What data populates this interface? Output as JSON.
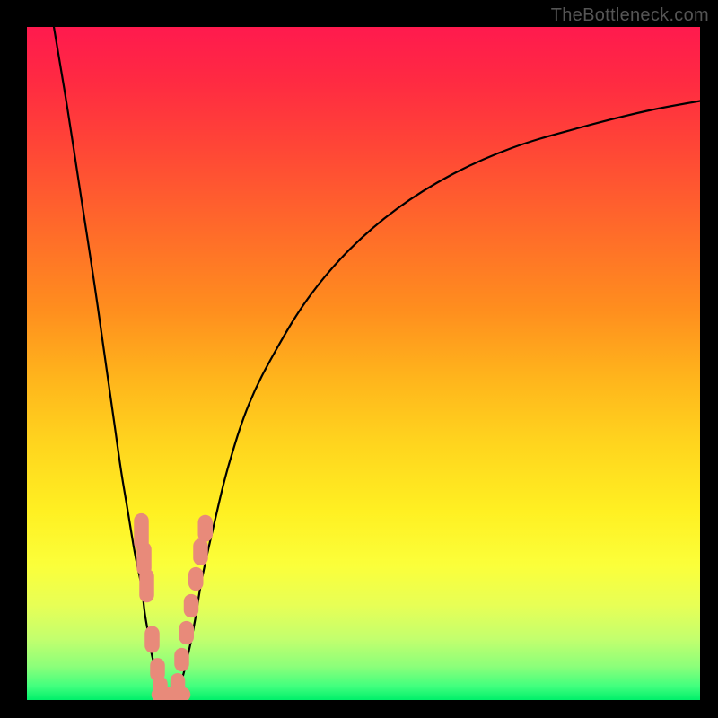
{
  "watermark": "TheBottleneck.com",
  "chart_data": {
    "type": "line",
    "title": "",
    "xlabel": "",
    "ylabel": "",
    "xlim": [
      0,
      100
    ],
    "ylim": [
      0,
      100
    ],
    "series": [
      {
        "name": "left-curve",
        "x": [
          4,
          6,
          8,
          10,
          12,
          13,
          14,
          15,
          16,
          17,
          17.5,
          18,
          18.5,
          19,
          19.5,
          20,
          20.5
        ],
        "values": [
          100,
          88,
          75,
          62,
          48,
          41,
          34,
          28,
          22,
          17,
          13,
          10,
          7,
          5,
          3.5,
          2,
          1
        ]
      },
      {
        "name": "right-curve",
        "x": [
          22,
          23,
          24,
          25,
          26,
          28,
          30,
          33,
          37,
          42,
          48,
          55,
          63,
          72,
          82,
          92,
          100
        ],
        "values": [
          1,
          3,
          7,
          12,
          18,
          27,
          35,
          44,
          52,
          60,
          67,
          73,
          78,
          82,
          85,
          87.5,
          89
        ]
      },
      {
        "name": "valley-floor",
        "x": [
          20.5,
          21,
          21.5,
          22
        ],
        "values": [
          1,
          0.5,
          0.5,
          1
        ]
      }
    ],
    "markers": [
      {
        "name": "left-markers",
        "points": [
          {
            "x": 17.0,
            "y": 25.0,
            "w": 2.2,
            "h": 5.5
          },
          {
            "x": 17.4,
            "y": 21.0,
            "w": 2.2,
            "h": 5.0
          },
          {
            "x": 17.8,
            "y": 17.0,
            "w": 2.2,
            "h": 5.0
          },
          {
            "x": 18.6,
            "y": 9.0,
            "w": 2.2,
            "h": 4.0
          },
          {
            "x": 19.4,
            "y": 4.5,
            "w": 2.2,
            "h": 3.5
          },
          {
            "x": 19.8,
            "y": 2.0,
            "w": 2.2,
            "h": 3.0
          }
        ]
      },
      {
        "name": "right-markers",
        "points": [
          {
            "x": 22.4,
            "y": 2.5,
            "w": 2.2,
            "h": 3.0
          },
          {
            "x": 23.0,
            "y": 6.0,
            "w": 2.2,
            "h": 3.5
          },
          {
            "x": 23.7,
            "y": 10.0,
            "w": 2.2,
            "h": 3.5
          },
          {
            "x": 24.4,
            "y": 14.0,
            "w": 2.2,
            "h": 3.5
          },
          {
            "x": 25.1,
            "y": 18.0,
            "w": 2.2,
            "h": 3.5
          },
          {
            "x": 25.8,
            "y": 22.0,
            "w": 2.2,
            "h": 4.0
          },
          {
            "x": 26.5,
            "y": 25.5,
            "w": 2.2,
            "h": 4.0
          }
        ]
      },
      {
        "name": "floor-markers",
        "points": [
          {
            "x": 20.0,
            "y": 0.8,
            "w": 3.0,
            "h": 2.2
          },
          {
            "x": 21.4,
            "y": 0.8,
            "w": 3.0,
            "h": 2.2
          },
          {
            "x": 22.8,
            "y": 0.8,
            "w": 3.0,
            "h": 2.2
          }
        ]
      }
    ],
    "marker_color": "#e88a7a",
    "curve_stroke": "#000000",
    "curve_width": 2.2
  }
}
